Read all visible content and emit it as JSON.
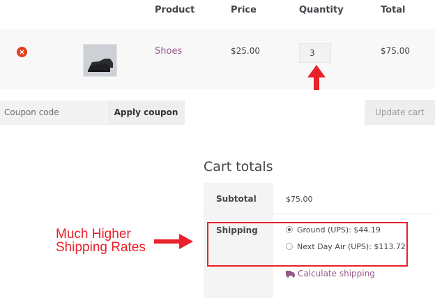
{
  "table": {
    "headers": {
      "product": "Product",
      "price": "Price",
      "quantity": "Quantity",
      "total": "Total"
    },
    "rows": [
      {
        "remove_symbol": "×",
        "product_name": "Shoes",
        "price": "$25.00",
        "quantity": "3",
        "total": "$75.00"
      }
    ]
  },
  "coupon": {
    "placeholder": "Coupon code",
    "apply_label": "Apply coupon",
    "update_label": "Update cart"
  },
  "totals": {
    "title": "Cart totals",
    "subtotal_label": "Subtotal",
    "subtotal_value": "$75.00",
    "shipping_label": "Shipping",
    "shipping_options": [
      {
        "label": "Ground (UPS): $44.19",
        "selected": true
      },
      {
        "label": "Next Day Air (UPS): $113.72",
        "selected": false
      }
    ],
    "calculate_shipping": "Calculate shipping"
  },
  "annotation": {
    "line1": "Much Higher",
    "line2": "Shipping Rates"
  },
  "colors": {
    "link_purple": "#96588a",
    "remove_red": "#e2401c",
    "annotation_red": "#e8212a"
  },
  "icons": {
    "remove": "remove-x-icon",
    "product_thumb": "shoe-thumbnail",
    "truck": "truck-icon",
    "annotation_arrow": "red-arrow-icon"
  }
}
